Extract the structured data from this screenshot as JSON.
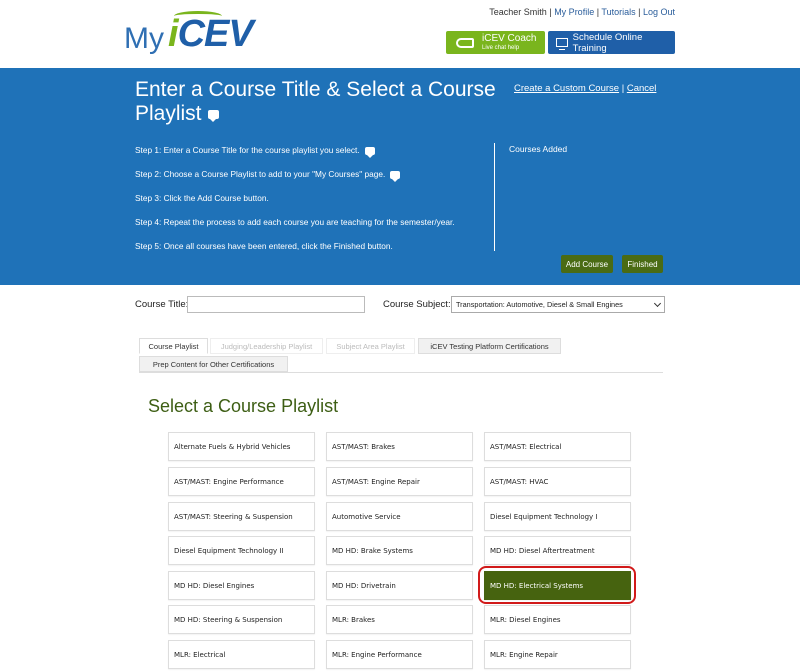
{
  "header": {
    "logo_my": "My",
    "logo_i": "i",
    "logo_cev": "CEV",
    "user_name": "Teacher Smith",
    "sep": "|",
    "links": [
      "My Profile",
      "Tutorials",
      "Log Out"
    ],
    "coach_title": "iCEV Coach",
    "coach_sub": "Live chat help",
    "training_label": "Schedule Online Training"
  },
  "banner": {
    "title": "Enter a Course Title & Select a Course Playlist",
    "create_custom": "Create a Custom Course",
    "link_sep": "|",
    "cancel": "Cancel",
    "steps": [
      "Step 1: Enter a Course Title for the course playlist you select.",
      "Step 2: Choose a Course Playlist to add to your \"My Courses\" page.",
      "Step 3: Click the Add Course button.",
      "Step 4: Repeat the process to add each course you are teaching for the semester/year.",
      "Step 5: Once all courses have been entered, click the Finished button."
    ],
    "courses_added": "Courses Added",
    "add_course": "Add Course",
    "finished": "Finished"
  },
  "form": {
    "course_title_label": "Course Title:",
    "course_title_value": "",
    "course_subject_label": "Course Subject:",
    "course_subject_value": "Transportation: Automotive, Diesel & Small Engines"
  },
  "tabs": [
    {
      "label": "Course Playlist",
      "state": "active"
    },
    {
      "label": "Judging/Leadership Playlist",
      "state": "disabled"
    },
    {
      "label": "Subject Area Playlist",
      "state": "disabled"
    },
    {
      "label": "iCEV Testing Platform Certifications",
      "state": "normal"
    },
    {
      "label": "Prep Content for Other Certifications",
      "state": "normal"
    }
  ],
  "playlist": {
    "title": "Select a Course Playlist",
    "items": [
      "Alternate Fuels & Hybrid Vehicles",
      "AST/MAST: Brakes",
      "AST/MAST: Electrical",
      "AST/MAST: Engine Performance",
      "AST/MAST: Engine Repair",
      "AST/MAST: HVAC",
      "AST/MAST: Steering & Suspension",
      "Automotive Service",
      "Diesel Equipment Technology I",
      "Diesel Equipment Technology II",
      "MD HD: Brake Systems",
      "MD HD: Diesel Aftertreatment",
      "MD HD: Diesel Engines",
      "MD HD: Drivetrain",
      "MD HD: Electrical Systems",
      "MD HD: Steering & Suspension",
      "MLR: Brakes",
      "MLR: Diesel Engines",
      "MLR: Electrical",
      "MLR: Engine Performance",
      "MLR: Engine Repair"
    ],
    "selected": "MD HD: Electrical Systems"
  },
  "colors": {
    "banner_blue": "#1f72b8",
    "brand_green": "#7ab51d",
    "dark_green": "#46630f",
    "highlight_red": "#d11a1a"
  }
}
